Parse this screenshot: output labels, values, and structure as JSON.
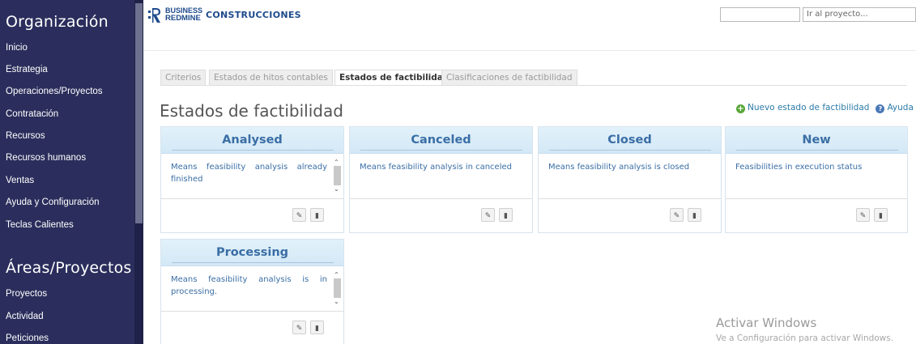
{
  "sidebar": {
    "heading1": "Organización",
    "items1": [
      "Inicio",
      "Estrategia",
      "Operaciones/Proyectos",
      "Contratación",
      "Recursos",
      "Recursos humanos",
      "Ventas",
      "Ayuda y Configuración",
      "Teclas Calientes"
    ],
    "heading2": "Áreas/Proyectos",
    "items2": [
      "Proyectos",
      "Actividad",
      "Peticiones"
    ]
  },
  "header": {
    "logo_line1": "BUSINESS",
    "logo_line2": "REDMINE",
    "project_name": "CONSTRUCCIONES",
    "jump_placeholder": "Ir al proyecto...",
    "brand_color": "#1e4a8c"
  },
  "tabs": [
    {
      "label": "Criterios",
      "active": false
    },
    {
      "label": "Estados de hitos contables",
      "active": false
    },
    {
      "label": "Estados de factibilidad",
      "active": true
    },
    {
      "label": "Clasificaciones de factibilidad",
      "active": false
    }
  ],
  "page": {
    "title": "Estados de factibilidad",
    "new_link": "Nuevo estado de factibilidad",
    "help_link": "Ayuda"
  },
  "cards": [
    {
      "title": "Analysed",
      "description": "Means feasibility analysis already finished",
      "has_scroll": true
    },
    {
      "title": "Canceled",
      "description": "Means feasibility analysis in canceled",
      "has_scroll": false
    },
    {
      "title": "Closed",
      "description": "Means feasibility analysis is closed",
      "has_scroll": false
    },
    {
      "title": "New",
      "description": "Feasibilities in execution status",
      "has_scroll": false
    },
    {
      "title": "Processing",
      "description": "Means feasibility analysis is in processing.",
      "has_scroll": true
    }
  ],
  "icons": {
    "edit": "edit-icon",
    "delete": "trash-icon",
    "add": "plus-circle-icon",
    "help": "help-circle-icon"
  },
  "watermark": {
    "line1": "Activar Windows",
    "line2": "Ve a Configuración para activar Windows."
  },
  "colors": {
    "sidebar_bg": "#2b2e5c",
    "card_title": "#3a6ea5",
    "link": "#2b7aa8"
  }
}
